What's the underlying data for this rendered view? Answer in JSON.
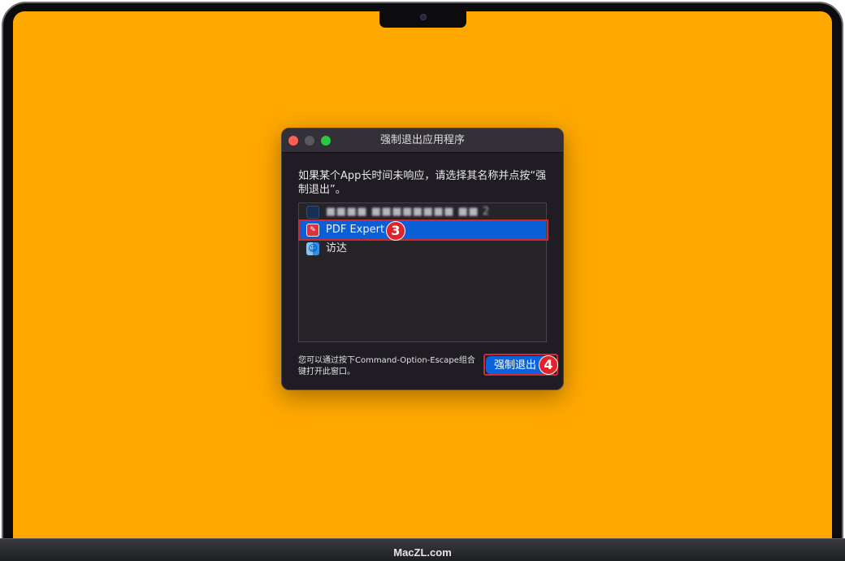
{
  "dialog": {
    "title": "强制退出应用程序",
    "message": "如果某个App长时间未响应，请选择其名称并点按“强制退出”。",
    "apps": [
      {
        "label": "■■■■ ■■■■■■■■ ■■ 2",
        "icon": "document-icon"
      },
      {
        "label": "PDF Expert",
        "icon": "pdf-expert-icon"
      },
      {
        "label": "访达",
        "icon": "finder-icon"
      }
    ],
    "footnote": "您可以通过按下Command-Option-Escape组合键打开此窗口。",
    "force_quit_label": "强制退出"
  },
  "annotations": {
    "step_3": "3",
    "step_4": "4"
  },
  "brand": "MacZL.com",
  "colors": {
    "screen_background": "#ffa800",
    "selection": "#0a5fd6",
    "annotation_red": "#e0242b"
  }
}
